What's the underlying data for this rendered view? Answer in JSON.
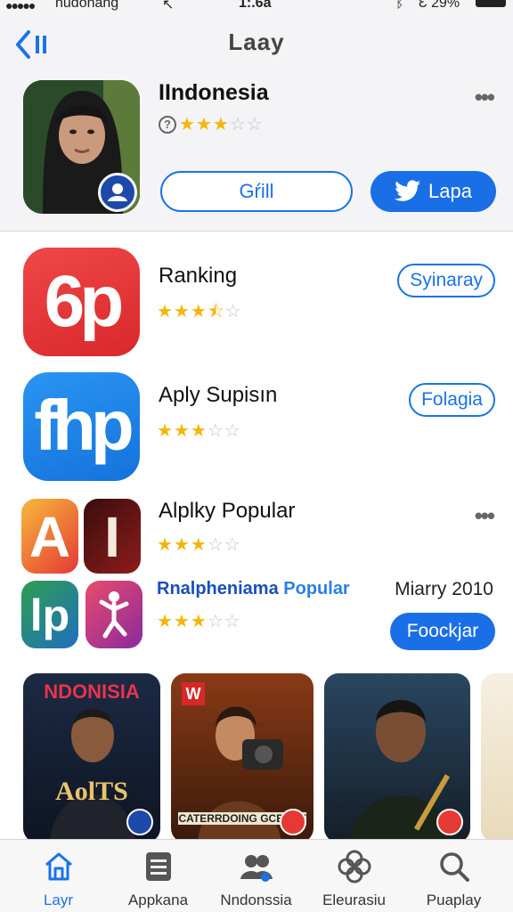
{
  "status_bar": {
    "carrier": "nudonang",
    "time": "1:.6a",
    "battery": "Ɛ 29%"
  },
  "nav": {
    "title": "Laay"
  },
  "featured": {
    "title": "IIndonesia",
    "rating": 3,
    "primary_button": "Gŕill",
    "twitter_button": "Lapa"
  },
  "apps": [
    {
      "title": "Ranking",
      "rating": 3.5,
      "action": "Syinaray",
      "icon_text": "6p"
    },
    {
      "title": "Aply Supisın",
      "rating": 3,
      "action": "Folagia",
      "icon_text": "fhp"
    },
    {
      "title": "Alplky Popular",
      "rating": 3,
      "subtitle_a": "Rnalpheniama",
      "subtitle_b": "Popular",
      "date": "Miarry 2010",
      "rating2": 3,
      "action": "Foockjar",
      "icon_text": [
        "A",
        "I",
        "lp",
        ""
      ]
    }
  ],
  "carousel": [
    {
      "title": "NDONISIA",
      "subtitle": "AolTS"
    },
    {
      "title": "W",
      "subtitle": "CATERRDOING GCENOT"
    },
    {
      "title": "",
      "subtitle": ""
    },
    {
      "title": "",
      "subtitle": ""
    }
  ],
  "tabs": [
    {
      "label": "Layr",
      "icon": "home-icon",
      "active": true
    },
    {
      "label": "Appkana",
      "icon": "apps-icon",
      "active": false
    },
    {
      "label": "Nndonssia",
      "icon": "people-icon",
      "active": false
    },
    {
      "label": "Eleurasiu",
      "icon": "flower-icon",
      "active": false
    },
    {
      "label": "Puaplay",
      "icon": "search-icon",
      "active": false
    }
  ],
  "colors": {
    "accent": "#1a73e8",
    "star": "#f5b50a"
  }
}
